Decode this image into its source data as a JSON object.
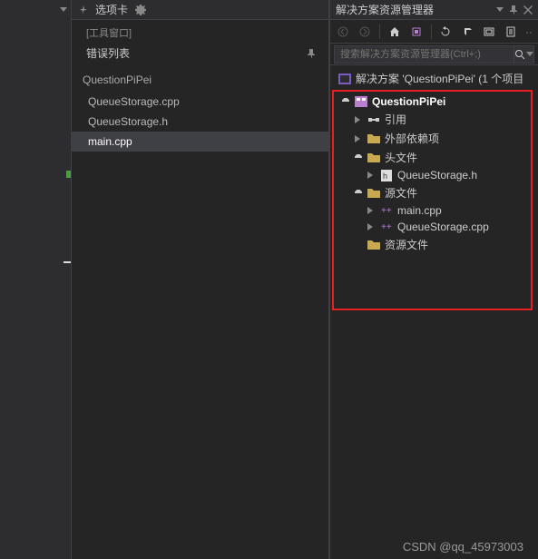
{
  "tabs": {
    "title": "选项卡",
    "tool_window_label": "[工具窗口]",
    "error_list_label": "错误列表"
  },
  "files": {
    "group_title": "QuestionPiPei",
    "items": [
      "QueueStorage.cpp",
      "QueueStorage.h",
      "main.cpp"
    ],
    "selected_index": 2
  },
  "solution": {
    "panel_title": "解决方案资源管理器",
    "search_placeholder": "搜索解决方案资源管理器(Ctrl+;)",
    "root_label": "解决方案 'QuestionPiPei' (1 个项目",
    "project_name": "QuestionPiPei",
    "nodes": {
      "references": "引用",
      "external_deps": "外部依赖项",
      "headers": "头文件",
      "header_file": "QueueStorage.h",
      "sources": "源文件",
      "source_main": "main.cpp",
      "source_queue": "QueueStorage.cpp",
      "resources": "资源文件"
    }
  },
  "watermark": "CSDN @qq_45973003"
}
